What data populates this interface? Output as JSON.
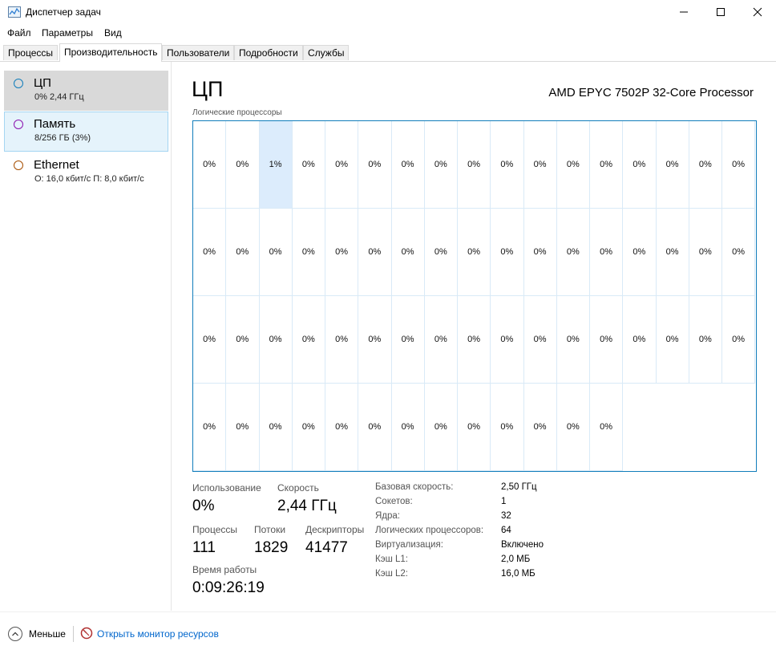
{
  "window": {
    "title": "Диспетчер задач"
  },
  "menu": [
    "Файл",
    "Параметры",
    "Вид"
  ],
  "tabs": [
    "Процессы",
    "Производительность",
    "Пользователи",
    "Подробности",
    "Службы"
  ],
  "sidebar": {
    "items": [
      {
        "name": "ЦП",
        "sub": "0% 2,44 ГГц",
        "color": "#117dbb"
      },
      {
        "name": "Память",
        "sub": "8/256 ГБ (3%)",
        "color": "#8b12ae"
      },
      {
        "name": "Ethernet",
        "sub": "О: 16,0 кбит/с П: 8,0 кбит/с",
        "color": "#a74f01"
      }
    ]
  },
  "main": {
    "title": "ЦП",
    "model": "AMD EPYC 7502P 32-Core Processor",
    "grid_label": "Логические процессоры",
    "logical_cpus": [
      "0%",
      "0%",
      "1%",
      "0%",
      "0%",
      "0%",
      "0%",
      "0%",
      "0%",
      "0%",
      "0%",
      "0%",
      "0%",
      "0%",
      "0%",
      "0%",
      "0%",
      "0%",
      "0%",
      "0%",
      "0%",
      "0%",
      "0%",
      "0%",
      "0%",
      "0%",
      "0%",
      "0%",
      "0%",
      "0%",
      "0%",
      "0%",
      "0%",
      "0%",
      "0%",
      "0%",
      "0%",
      "0%",
      "0%",
      "0%",
      "0%",
      "0%",
      "0%",
      "0%",
      "0%",
      "0%",
      "0%",
      "0%",
      "0%",
      "0%",
      "0%",
      "0%",
      "0%",
      "0%",
      "0%",
      "0%",
      "0%",
      "0%",
      "0%",
      "0%",
      "0%",
      "0%",
      "0%",
      "0%"
    ],
    "highlighted_cpu": 2
  },
  "stats": {
    "usage_label": "Использование",
    "usage": "0%",
    "speed_label": "Скорость",
    "speed": "2,44 ГГц",
    "processes_label": "Процессы",
    "processes": "111",
    "threads_label": "Потоки",
    "threads": "1829",
    "handles_label": "Дескрипторы",
    "handles": "41477",
    "uptime_label": "Время работы",
    "uptime": "0:09:26:19"
  },
  "info": [
    {
      "label": "Базовая скорость:",
      "value": "2,50 ГГц"
    },
    {
      "label": "Сокетов:",
      "value": "1"
    },
    {
      "label": "Ядра:",
      "value": "32"
    },
    {
      "label": "Логических процессоров:",
      "value": "64"
    },
    {
      "label": "Виртуализация:",
      "value": "Включено"
    },
    {
      "label": "Кэш L1:",
      "value": "2,0 МБ"
    },
    {
      "label": "Кэш L2:",
      "value": "16,0 МБ"
    }
  ],
  "footer": {
    "less": "Меньше",
    "monitor": "Открыть монитор ресурсов"
  }
}
